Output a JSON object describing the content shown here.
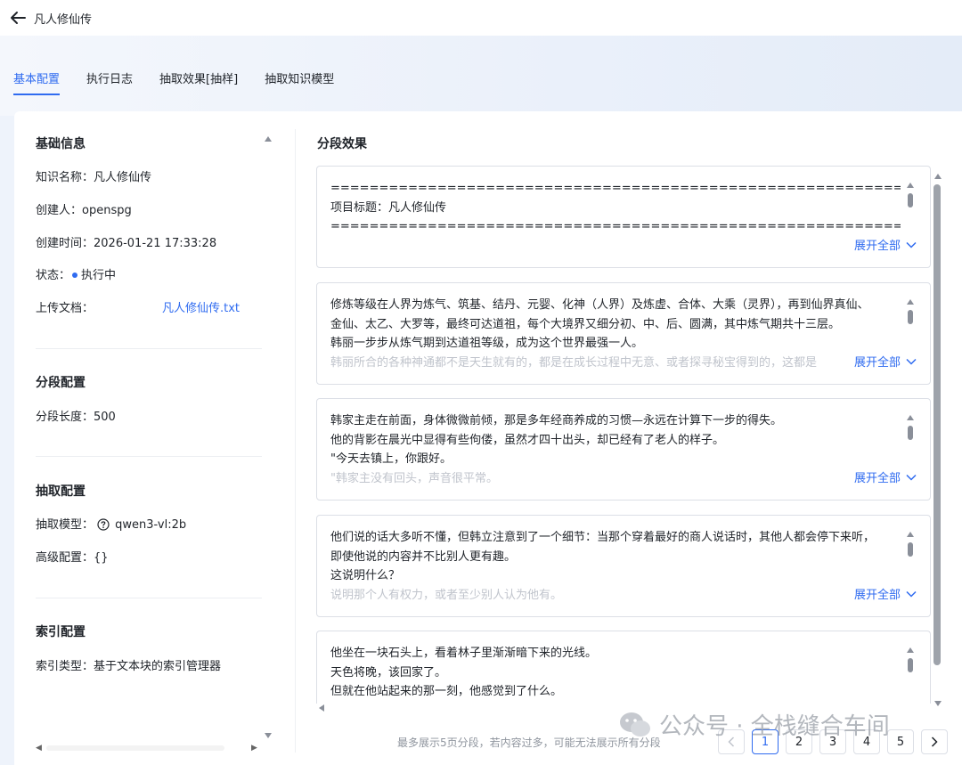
{
  "header": {
    "title": "凡人修仙传"
  },
  "tabs": [
    {
      "label": "基本配置",
      "active": true
    },
    {
      "label": "执行日志"
    },
    {
      "label": "抽取效果[抽样]"
    },
    {
      "label": "抽取知识模型"
    }
  ],
  "basic_info": {
    "heading": "基础信息",
    "name_label": "知识名称：",
    "name_value": "凡人修仙传",
    "creator_label": "创建人：",
    "creator_value": "openspg",
    "created_label": "创建时间：",
    "created_value": "2026-01-21 17:33:28",
    "status_label": "状态：",
    "status_value": "执行中",
    "upload_label": "上传文档：",
    "upload_value": "凡人修仙传.txt"
  },
  "segment_config": {
    "heading": "分段配置",
    "length_label": "分段长度：",
    "length_value": "500"
  },
  "extract_config": {
    "heading": "抽取配置",
    "model_label": "抽取模型：",
    "model_value": "qwen3-vl:2b",
    "advanced_label": "高级配置：",
    "advanced_value": "{}"
  },
  "index_config": {
    "heading": "索引配置",
    "type_label": "索引类型：",
    "type_value": "基于文本块的索引管理器"
  },
  "segments_panel": {
    "title": "分段效果",
    "expand_label": "展开全部",
    "segments": [
      {
        "lines": [
          "==========================================================================",
          "项目标题：凡人修仙传",
          "=========================================================================="
        ],
        "faded": ""
      },
      {
        "lines": [
          "修炼等级在人界为炼气、筑基、结丹、元婴、化神（人界）及炼虚、合体、大乘（灵界），再到仙界真仙、",
          "金仙、太乙、大罗等，最终可达道祖，每个大境界又细分初、中、后、圆满，其中炼气期共十三层。",
          "韩丽一步步从炼气期到达道祖等级，成为这个世界最强一人。"
        ],
        "faded": "韩丽所合的各种神通都不是天生就有的，都是在成长过程中无意、或者探寻秘宝得到的，这都是"
      },
      {
        "lines": [
          "韩家主走在前面，身体微微前倾，那是多年经商养成的习惯—永远在计算下一步的得失。",
          "他的背影在晨光中显得有些佝偻，虽然才四十出头，却已经有了老人的样子。",
          "\"今天去镇上，你跟好。"
        ],
        "faded": "\"韩家主没有回头，声音很平常。"
      },
      {
        "lines": [
          "他们说的话大多听不懂，但韩立注意到了一个细节：当那个穿着最好的商人说话时，其他人都会停下来听，",
          "即使他说的内容并不比别人更有趣。",
          "这说明什么？"
        ],
        "faded": "说明那个人有权力，或者至少别人认为他有。"
      },
      {
        "lines": [
          "他坐在一块石头上，看着林子里渐渐暗下来的光线。",
          "天色将晚，该回家了。",
          "但就在他站起来的那一刻，他感觉到了什么。"
        ],
        "faded": ""
      }
    ],
    "footnote": "最多展示5页分段，若内容过多，可能无法展示所有分段",
    "pages": [
      "1",
      "2",
      "3",
      "4",
      "5"
    ],
    "current_page": "1"
  },
  "watermark": {
    "text": "公众号 · 全栈缝合车间"
  },
  "colors": {
    "accent": "#2f6bf0",
    "text": "#1f2329",
    "muted": "#8f959e",
    "border": "#dcdfe6"
  },
  "icons": [
    "back-arrow-icon",
    "help-circle-icon",
    "chevron-down-icon",
    "chevron-left-icon",
    "chevron-right-icon",
    "wechat-icon"
  ]
}
